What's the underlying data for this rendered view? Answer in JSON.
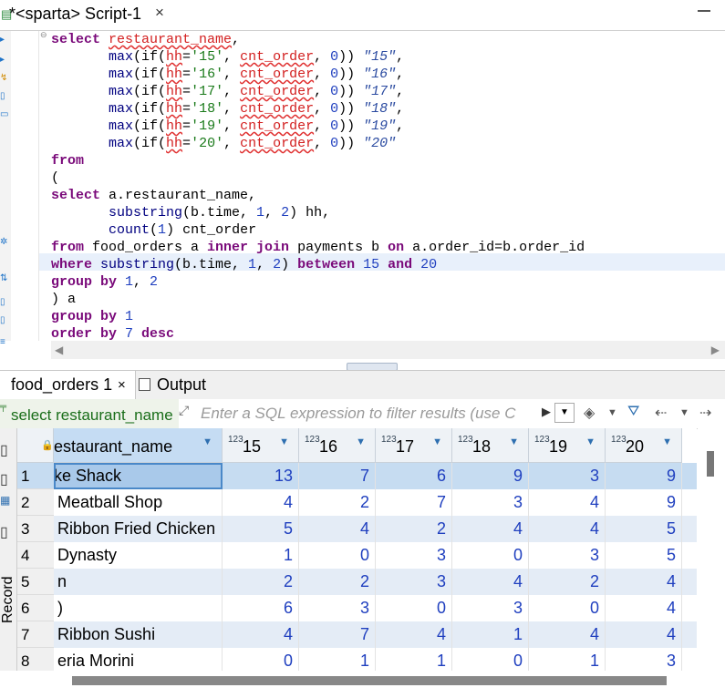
{
  "editor_tab": {
    "title": "*<sparta> Script-1",
    "close": "×"
  },
  "sql_lines": [
    [
      {
        "t": "select ",
        "c": "kw"
      },
      {
        "t": "restaurant_name",
        "c": "err"
      },
      {
        "t": ",",
        "c": ""
      }
    ],
    [
      {
        "t": "       max",
        "c": "fn"
      },
      {
        "t": "(if(",
        "c": ""
      },
      {
        "t": "hh",
        "c": "err"
      },
      {
        "t": "=",
        "c": ""
      },
      {
        "t": "'15'",
        "c": "str"
      },
      {
        "t": ", ",
        "c": ""
      },
      {
        "t": "cnt_order",
        "c": "err"
      },
      {
        "t": ", ",
        "c": ""
      },
      {
        "t": "0",
        "c": "num"
      },
      {
        "t": ")) ",
        "c": ""
      },
      {
        "t": "\"15\"",
        "c": "qid"
      },
      {
        "t": ",",
        "c": ""
      }
    ],
    [
      {
        "t": "       max",
        "c": "fn"
      },
      {
        "t": "(if(",
        "c": ""
      },
      {
        "t": "hh",
        "c": "err"
      },
      {
        "t": "=",
        "c": ""
      },
      {
        "t": "'16'",
        "c": "str"
      },
      {
        "t": ", ",
        "c": ""
      },
      {
        "t": "cnt_order",
        "c": "err"
      },
      {
        "t": ", ",
        "c": ""
      },
      {
        "t": "0",
        "c": "num"
      },
      {
        "t": ")) ",
        "c": ""
      },
      {
        "t": "\"16\"",
        "c": "qid"
      },
      {
        "t": ",",
        "c": ""
      }
    ],
    [
      {
        "t": "       max",
        "c": "fn"
      },
      {
        "t": "(if(",
        "c": ""
      },
      {
        "t": "hh",
        "c": "err"
      },
      {
        "t": "=",
        "c": ""
      },
      {
        "t": "'17'",
        "c": "str"
      },
      {
        "t": ", ",
        "c": ""
      },
      {
        "t": "cnt_order",
        "c": "err"
      },
      {
        "t": ", ",
        "c": ""
      },
      {
        "t": "0",
        "c": "num"
      },
      {
        "t": ")) ",
        "c": ""
      },
      {
        "t": "\"17\"",
        "c": "qid"
      },
      {
        "t": ",",
        "c": ""
      }
    ],
    [
      {
        "t": "       max",
        "c": "fn"
      },
      {
        "t": "(if(",
        "c": ""
      },
      {
        "t": "hh",
        "c": "err"
      },
      {
        "t": "=",
        "c": ""
      },
      {
        "t": "'18'",
        "c": "str"
      },
      {
        "t": ", ",
        "c": ""
      },
      {
        "t": "cnt_order",
        "c": "err"
      },
      {
        "t": ", ",
        "c": ""
      },
      {
        "t": "0",
        "c": "num"
      },
      {
        "t": ")) ",
        "c": ""
      },
      {
        "t": "\"18\"",
        "c": "qid"
      },
      {
        "t": ",",
        "c": ""
      }
    ],
    [
      {
        "t": "       max",
        "c": "fn"
      },
      {
        "t": "(if(",
        "c": ""
      },
      {
        "t": "hh",
        "c": "err"
      },
      {
        "t": "=",
        "c": ""
      },
      {
        "t": "'19'",
        "c": "str"
      },
      {
        "t": ", ",
        "c": ""
      },
      {
        "t": "cnt_order",
        "c": "err"
      },
      {
        "t": ", ",
        "c": ""
      },
      {
        "t": "0",
        "c": "num"
      },
      {
        "t": ")) ",
        "c": ""
      },
      {
        "t": "\"19\"",
        "c": "qid"
      },
      {
        "t": ",",
        "c": ""
      }
    ],
    [
      {
        "t": "       max",
        "c": "fn"
      },
      {
        "t": "(if(",
        "c": ""
      },
      {
        "t": "hh",
        "c": "err"
      },
      {
        "t": "=",
        "c": ""
      },
      {
        "t": "'20'",
        "c": "str"
      },
      {
        "t": ", ",
        "c": ""
      },
      {
        "t": "cnt_order",
        "c": "err"
      },
      {
        "t": ", ",
        "c": ""
      },
      {
        "t": "0",
        "c": "num"
      },
      {
        "t": ")) ",
        "c": ""
      },
      {
        "t": "\"20\"",
        "c": "qid"
      }
    ],
    [
      {
        "t": "from",
        "c": "kw"
      }
    ],
    [
      {
        "t": "(",
        "c": ""
      }
    ],
    [
      {
        "t": "select ",
        "c": "kw"
      },
      {
        "t": "a.restaurant_name,",
        "c": ""
      }
    ],
    [
      {
        "t": "       substring",
        "c": "fn"
      },
      {
        "t": "(b.time, ",
        "c": ""
      },
      {
        "t": "1",
        "c": "num"
      },
      {
        "t": ", ",
        "c": ""
      },
      {
        "t": "2",
        "c": "num"
      },
      {
        "t": ") hh,",
        "c": ""
      }
    ],
    [
      {
        "t": "       count",
        "c": "fn"
      },
      {
        "t": "(",
        "c": ""
      },
      {
        "t": "1",
        "c": "num"
      },
      {
        "t": ") cnt_order",
        "c": ""
      }
    ],
    [
      {
        "t": "from ",
        "c": "kw"
      },
      {
        "t": "food_orders a ",
        "c": ""
      },
      {
        "t": "inner join ",
        "c": "kw"
      },
      {
        "t": "payments b ",
        "c": ""
      },
      {
        "t": "on ",
        "c": "kw"
      },
      {
        "t": "a.order_id=b.order_id",
        "c": ""
      }
    ],
    [
      {
        "t": "where ",
        "c": "kw"
      },
      {
        "t": "substring",
        "c": "fn"
      },
      {
        "t": "(b.time, ",
        "c": ""
      },
      {
        "t": "1",
        "c": "num"
      },
      {
        "t": ", ",
        "c": ""
      },
      {
        "t": "2",
        "c": "num"
      },
      {
        "t": ") ",
        "c": ""
      },
      {
        "t": "between ",
        "c": "kw"
      },
      {
        "t": "15",
        "c": "num"
      },
      {
        "t": " ",
        "c": ""
      },
      {
        "t": "and ",
        "c": "kw"
      },
      {
        "t": "20",
        "c": "num"
      }
    ],
    [
      {
        "t": "group by ",
        "c": "kw"
      },
      {
        "t": "1",
        "c": "num"
      },
      {
        "t": ", ",
        "c": ""
      },
      {
        "t": "2",
        "c": "num"
      }
    ],
    [
      {
        "t": ") a",
        "c": ""
      }
    ],
    [
      {
        "t": "group by ",
        "c": "kw"
      },
      {
        "t": "1",
        "c": "num"
      }
    ],
    [
      {
        "t": "order by ",
        "c": "kw"
      },
      {
        "t": "7",
        "c": "num"
      },
      {
        "t": " ",
        "c": ""
      },
      {
        "t": "desc",
        "c": "kw"
      }
    ]
  ],
  "result_tabs": {
    "results_label": "food_orders 1",
    "results_close": "×",
    "output_label": "Output"
  },
  "filter_bar": {
    "query_text": "select restaurant_name",
    "placeholder": "Enter a SQL expression to filter results (use C"
  },
  "side_panel": {
    "vertical_label": "Record"
  },
  "table": {
    "columns": [
      {
        "label": "estaurant_name",
        "type": ""
      },
      {
        "label": "15",
        "type": "123"
      },
      {
        "label": "16",
        "type": "123"
      },
      {
        "label": "17",
        "type": "123"
      },
      {
        "label": "18",
        "type": "123"
      },
      {
        "label": "19",
        "type": "123"
      },
      {
        "label": "20",
        "type": "123"
      }
    ],
    "rows": [
      {
        "n": "1",
        "name": "ke Shack",
        "v": [
          "13",
          "7",
          "6",
          "9",
          "3",
          "9"
        ]
      },
      {
        "n": "2",
        "name": "Meatball Shop",
        "v": [
          "4",
          "2",
          "7",
          "3",
          "4",
          "9"
        ]
      },
      {
        "n": "3",
        "name": "Ribbon Fried Chicken",
        "v": [
          "5",
          "4",
          "2",
          "4",
          "4",
          "5"
        ]
      },
      {
        "n": "4",
        "name": "Dynasty",
        "v": [
          "1",
          "0",
          "3",
          "0",
          "3",
          "5"
        ]
      },
      {
        "n": "5",
        "name": "n",
        "v": [
          "2",
          "2",
          "3",
          "4",
          "2",
          "4"
        ]
      },
      {
        "n": "6",
        "name": ")",
        "v": [
          "6",
          "3",
          "0",
          "3",
          "0",
          "4"
        ]
      },
      {
        "n": "7",
        "name": "Ribbon Sushi",
        "v": [
          "4",
          "7",
          "4",
          "1",
          "4",
          "4"
        ]
      },
      {
        "n": "8",
        "name": "eria Morini",
        "v": [
          "0",
          "1",
          "1",
          "0",
          "1",
          "3"
        ]
      }
    ]
  },
  "colors": {
    "keyword": "#7a0a7a",
    "error_underline": "#e03030",
    "selected_row": "#c6dcf1",
    "alt_row": "#e4ecf6"
  }
}
